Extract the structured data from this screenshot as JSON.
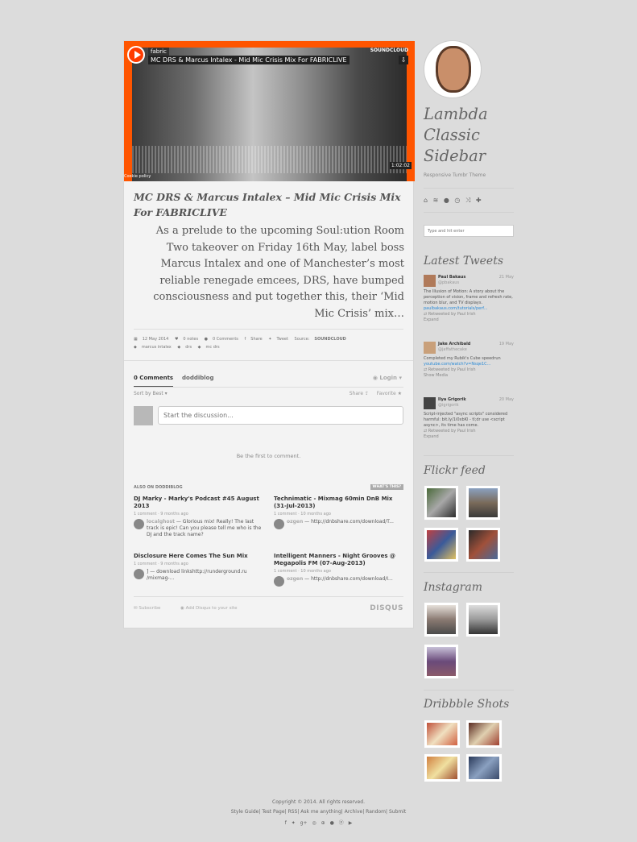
{
  "player": {
    "user": "fabric",
    "title": "MC DRS & Marcus Intalex - Mid Mic Crisis Mix For FABRICLIVE",
    "brand": "SOUNDCLOUD",
    "duration": "1:02:02",
    "cookie": "Cookie policy"
  },
  "post": {
    "title": "MC DRS & Marcus Intalex – Mid Mic Crisis Mix For FABRICLIVE",
    "body": "As a prelude to the upcoming Soul:ution Room Two takeover on Friday 16th May, label boss Marcus Intalex and one of Manchester’s most reliable renegade emcees, DRS, have bumped consciousness and put together this, their ‘Mid Mic Crisis’ mix…",
    "meta": {
      "date": "12 May 2014",
      "notes": "0 notes",
      "comments": "0 Comments",
      "share": "Share",
      "tweet": "Tweet",
      "source_label": "Source:",
      "source": "SOUNDCLOUD"
    },
    "tags": [
      "marcus intalex",
      "drs",
      "mc drs"
    ]
  },
  "disqus": {
    "tab_comments": "0 Comments",
    "tab_blog": "doddiblog",
    "login": "Login",
    "sort": "Sort by Best",
    "share": "Share",
    "favorite": "Favorite",
    "placeholder": "Start the discussion...",
    "first": "Be the first to comment.",
    "also_on": "ALSO ON DODDIBLOG",
    "whats_this": "WHAT'S THIS?",
    "related": [
      {
        "title": "DJ Marky - Marky's Podcast #45 August 2013",
        "count": "1 comment · 9 months ago",
        "user": "localghost",
        "text": "— Glorious mix! Really! The last track is epic! Can you please tell me who is the DJ and the track name?"
      },
      {
        "title": "Technimatic - Mixmag 60min DnB Mix (31-Jul-2013)",
        "count": "1 comment · 10 months ago",
        "user": "ozgen",
        "text": "— http://dnbshare.com/download/T..."
      },
      {
        "title": "Disclosure Here Comes The Sun Mix",
        "count": "1 comment · 9 months ago",
        "user": "",
        "text": "] — download linkshttp://runderground.ru /mixmag-..."
      },
      {
        "title": "Intelligent Manners - Night Grooves @ Megapolis FM (07-Aug-2013)",
        "count": "1 comment · 10 months ago",
        "user": "ozgen",
        "text": "— http://dnbshare.com/download/I..."
      }
    ],
    "subscribe": "Subscribe",
    "add": "Add Disqus to your site",
    "brand": "DISQUS"
  },
  "sidebar": {
    "blog_title": "Lambda Classic Sidebar",
    "subtitle": "Responsive Tumbr Theme",
    "search_placeholder": "Type and hit enter",
    "tweets_heading": "Latest Tweets",
    "tweets": [
      {
        "name": "Paul Bakaus",
        "handle": "@pbakaus",
        "date": "21 May",
        "text": "The Illusion of Motion: A story about the perception of vision, frame and refresh rate, motion blur, and TV displays.",
        "link": "paulbakaus.com/tutorials/perf...",
        "rt": "Retweeted by Paul Irish",
        "action": "Expand"
      },
      {
        "name": "Jake Archibald",
        "handle": "@jaffathecake",
        "date": "19 May",
        "text": "Completed my Rubik's Cube speedrun",
        "link": "youtube.com/watch?v=Nsqe1C...",
        "rt": "Retweeted by Paul Irish",
        "action": "Show Media"
      },
      {
        "name": "Ilya Grigorik",
        "handle": "@igrigorik",
        "date": "20 May",
        "text": "Script-injected \"async scripts\" considered harmful: bit.ly/1i0xbKl - tl;dr use <script async>, its time has come.",
        "link": "",
        "rt": "Retweeted by Paul Irish",
        "action": "Expand"
      }
    ],
    "flickr_heading": "Flickr feed",
    "instagram_heading": "Instagram",
    "dribbble_heading": "Dribbble Shots"
  },
  "footer": {
    "copyright": "Copyright © 2014. All rights reserved.",
    "links": [
      "Style Guide",
      "Test Page",
      "RSS",
      "Ask me anything",
      "Archive",
      "Random",
      "Submit"
    ]
  }
}
